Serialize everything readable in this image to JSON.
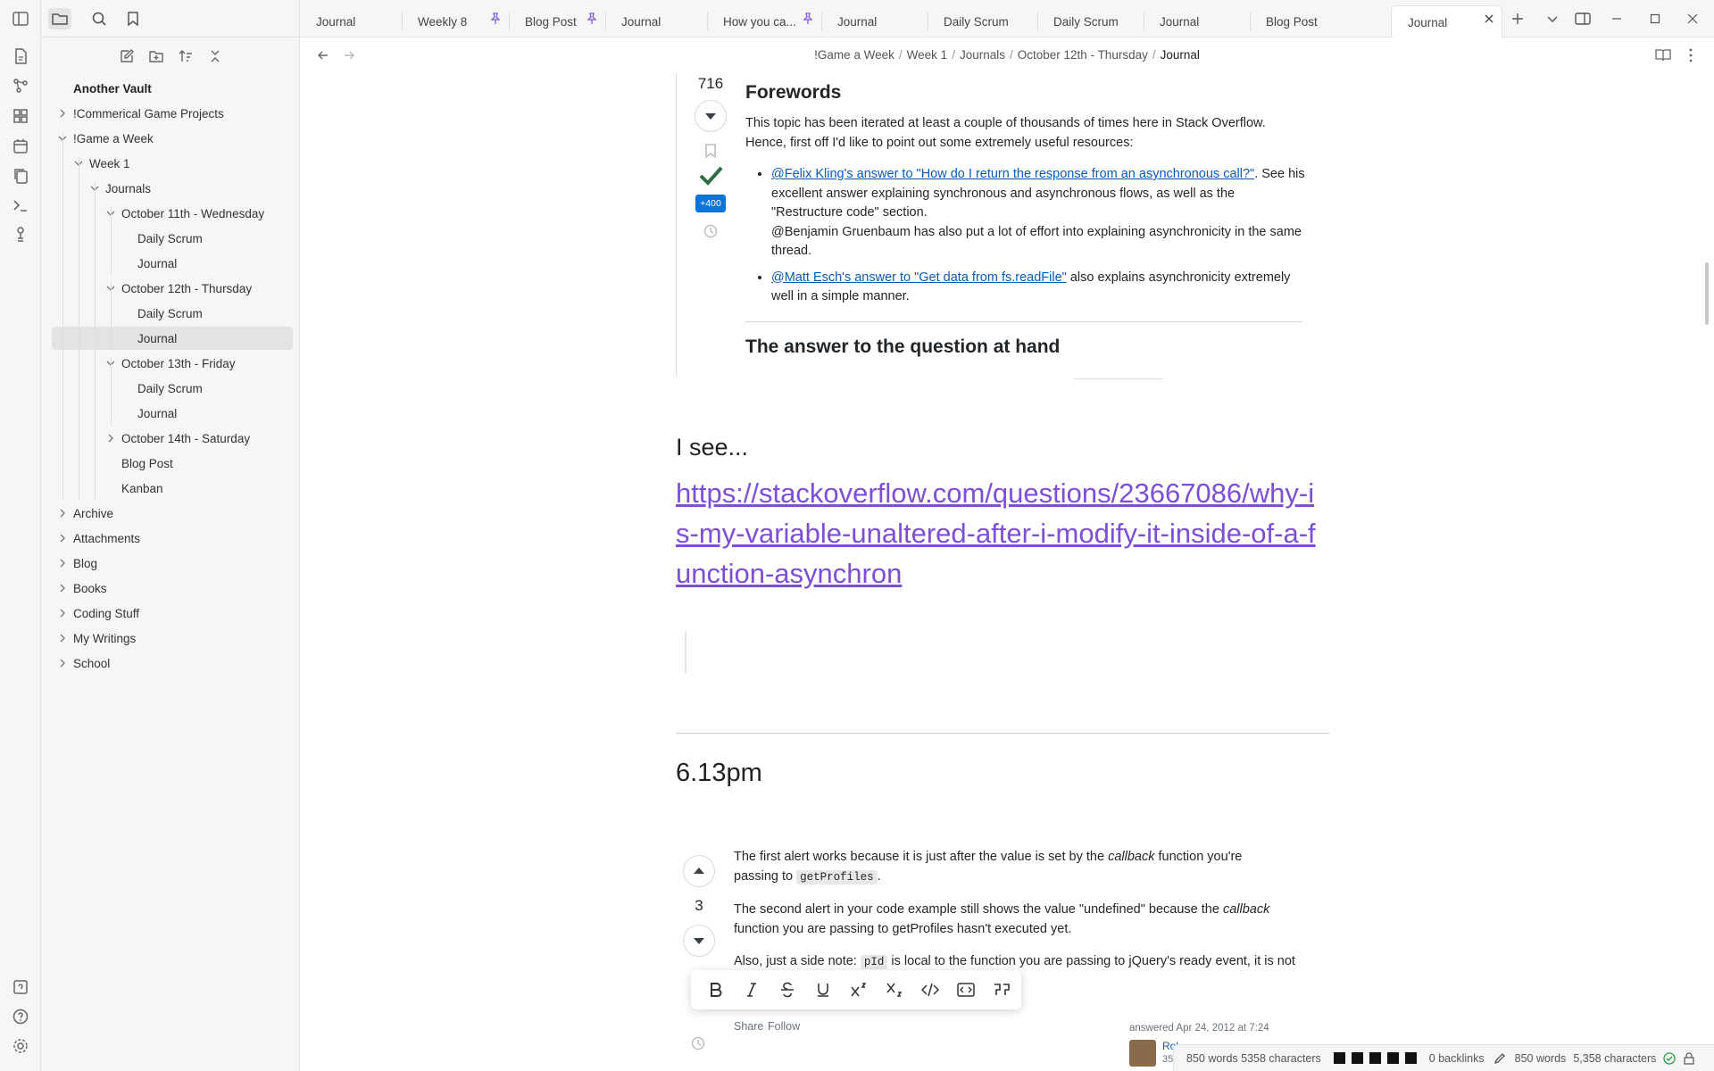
{
  "sidebar": {
    "vault_name": "Another Vault",
    "tree": [
      {
        "label": "!Commerical Game Projects",
        "chevron": "right"
      },
      {
        "label": "!Game a Week",
        "chevron": "down"
      },
      {
        "label": "Week 1",
        "chevron": "down"
      },
      {
        "label": "Journals",
        "chevron": "down"
      },
      {
        "label": "October 11th - Wednesday",
        "chevron": "down"
      },
      {
        "label": "Daily Scrum",
        "chevron": "none"
      },
      {
        "label": "Journal",
        "chevron": "none"
      },
      {
        "label": "October 12th - Thursday",
        "chevron": "down"
      },
      {
        "label": "Daily Scrum",
        "chevron": "none"
      },
      {
        "label": "Journal",
        "chevron": "none",
        "selected": true
      },
      {
        "label": "October 13th - Friday",
        "chevron": "down"
      },
      {
        "label": "Daily Scrum",
        "chevron": "none"
      },
      {
        "label": "Journal",
        "chevron": "none"
      },
      {
        "label": "October 14th - Saturday",
        "chevron": "right"
      },
      {
        "label": "Blog Post",
        "chevron": "none"
      },
      {
        "label": "Kanban",
        "chevron": "none"
      },
      {
        "label": "Archive",
        "chevron": "right"
      },
      {
        "label": "Attachments",
        "chevron": "right"
      },
      {
        "label": "Blog",
        "chevron": "right"
      },
      {
        "label": "Books",
        "chevron": "right"
      },
      {
        "label": "Coding Stuff",
        "chevron": "right"
      },
      {
        "label": "My Writings",
        "chevron": "right"
      },
      {
        "label": "School",
        "chevron": "right"
      }
    ]
  },
  "tabs": [
    {
      "label": "Journal",
      "pinned": false
    },
    {
      "label": "Weekly 8",
      "pinned": true
    },
    {
      "label": "Blog Post",
      "pinned": true
    },
    {
      "label": "Journal",
      "pinned": false
    },
    {
      "label": "How you ca...",
      "pinned": true
    },
    {
      "label": "Journal",
      "pinned": false
    },
    {
      "label": "Daily Scrum",
      "pinned": false
    },
    {
      "label": "Daily Scrum",
      "pinned": false
    },
    {
      "label": "Journal",
      "pinned": false
    },
    {
      "label": "Blog Post",
      "pinned": false
    },
    {
      "label": "Journal",
      "pinned": false,
      "active": true
    }
  ],
  "breadcrumb": [
    "!Game a Week",
    "Week 1",
    "Journals",
    "October 12th - Thursday",
    "Journal"
  ],
  "embed1": {
    "vote_count": "716",
    "bounty": "+400",
    "heading": "Forewords",
    "intro": "This topic has been iterated at least a couple of thousands of times here in Stack Overflow. Hence, first off I'd like to point out some extremely useful resources:",
    "b1_link": "@Felix Kling's answer to \"How do I return the response from an asynchronous call?\"",
    "b1_rest": ". See his excellent answer explaining synchronous and asynchronous flows, as well as the \"Restructure code\" section.",
    "b1_extra": "@Benjamin Gruenbaum has also put a lot of effort into explaining asynchronicity in the same thread.",
    "b2_link": "@Matt Esch's answer to \"Get data from fs.readFile\"",
    "b2_rest": " also explains asynchronicity extremely well in a simple manner.",
    "heading2": "The answer to the question at hand"
  },
  "note": {
    "i_see": "I see...",
    "link": "https://stackoverflow.com/questions/23667086/why-is-my-variable-unaltered-after-i-modify-it-inside-of-a-function-asynchron",
    "time_heading": "6.13pm"
  },
  "embed2": {
    "vote_count": "3",
    "p1_a": "The first alert works because it is just after the value is set by the ",
    "p1_em": "callback",
    "p1_b": " function you're passing to ",
    "p1_code": "getProfiles",
    "p1_c": ".",
    "p2_a": "The second alert in your code example still shows the value \"undefined\" because the ",
    "p2_em": "callback",
    "p2_b": " function you are passing to getProfiles hasn't executed yet.",
    "p3_a": "Also, just a side note: ",
    "p3_code": "pId",
    "p3_b": " is local to the function you are passing to jQuery's ready event, it is not",
    "share": "Share",
    "follow": "Follow",
    "answered": "answered Apr 24, 2012 at 7:24",
    "user_short": "Rol",
    "user_rep": "35.",
    "wordcount_inline": "850 words 5358 characters"
  },
  "status": {
    "backlinks": "0 backlinks",
    "words": "850 words",
    "chars": "5,358 characters"
  },
  "colors": {
    "accent": "#7c4fd6",
    "so_link": "#0a5ab5",
    "so_accept": "#2f6f44",
    "bounty_bg": "#0a75d4"
  }
}
